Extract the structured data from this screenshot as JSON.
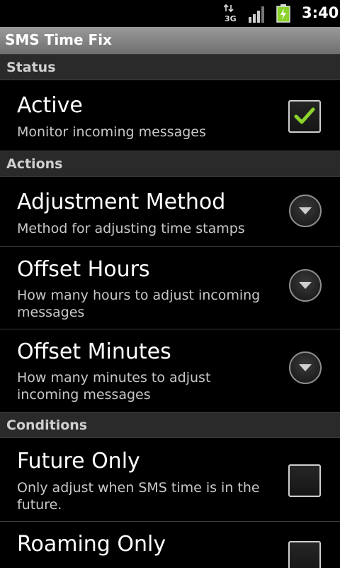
{
  "status_bar": {
    "network_label": "3G",
    "time": "3:40",
    "icons": [
      "data-transfer-icon",
      "signal-strength-icon",
      "battery-charging-icon"
    ]
  },
  "app": {
    "title": "SMS Time Fix"
  },
  "categories": {
    "status": "Status",
    "actions": "Actions",
    "conditions": "Conditions"
  },
  "preferences": {
    "active": {
      "title": "Active",
      "summary": "Monitor incoming messages",
      "checked": true
    },
    "adjustment_method": {
      "title": "Adjustment Method",
      "summary": "Method for adjusting time stamps"
    },
    "offset_hours": {
      "title": "Offset Hours",
      "summary": "How many hours to adjust incoming messages"
    },
    "offset_minutes": {
      "title": "Offset Minutes",
      "summary": "How many minutes to adjust incoming messages"
    },
    "future_only": {
      "title": "Future Only",
      "summary": "Only adjust when SMS time is in the future.",
      "checked": false
    },
    "roaming_only": {
      "title": "Roaming Only",
      "checked": false
    }
  },
  "colors": {
    "check_mark": "#8bd22c",
    "battery": "#8bd22c",
    "category_bg": "#2a2a2a",
    "title_bar": "#8a8a8a"
  }
}
